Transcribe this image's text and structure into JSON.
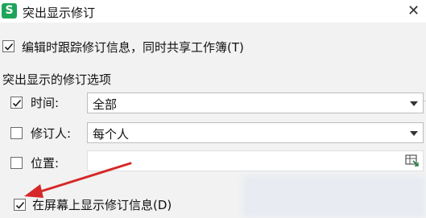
{
  "dialog": {
    "app_icon_letter": "S",
    "title": "突出显示修订",
    "close_glyph": "✕"
  },
  "track_option": {
    "label": "编辑时跟踪修订信息，同时共享工作簿(T)",
    "checked": true
  },
  "group": {
    "title": "突出显示的修订选项"
  },
  "when": {
    "label": "时间:",
    "checked": true,
    "value": "全部"
  },
  "who": {
    "label": "修订人:",
    "checked": false,
    "value": "每个人"
  },
  "where": {
    "label": "位置:",
    "checked": false,
    "value": "",
    "picker_icon": "range-picker-icon"
  },
  "onscreen": {
    "label": "在屏幕上显示修订信息(D)",
    "checked": true
  },
  "colors": {
    "checkmark": "#1a1a1a",
    "annotation_arrow": "#d62828",
    "app_icon": "#1ea45a"
  }
}
